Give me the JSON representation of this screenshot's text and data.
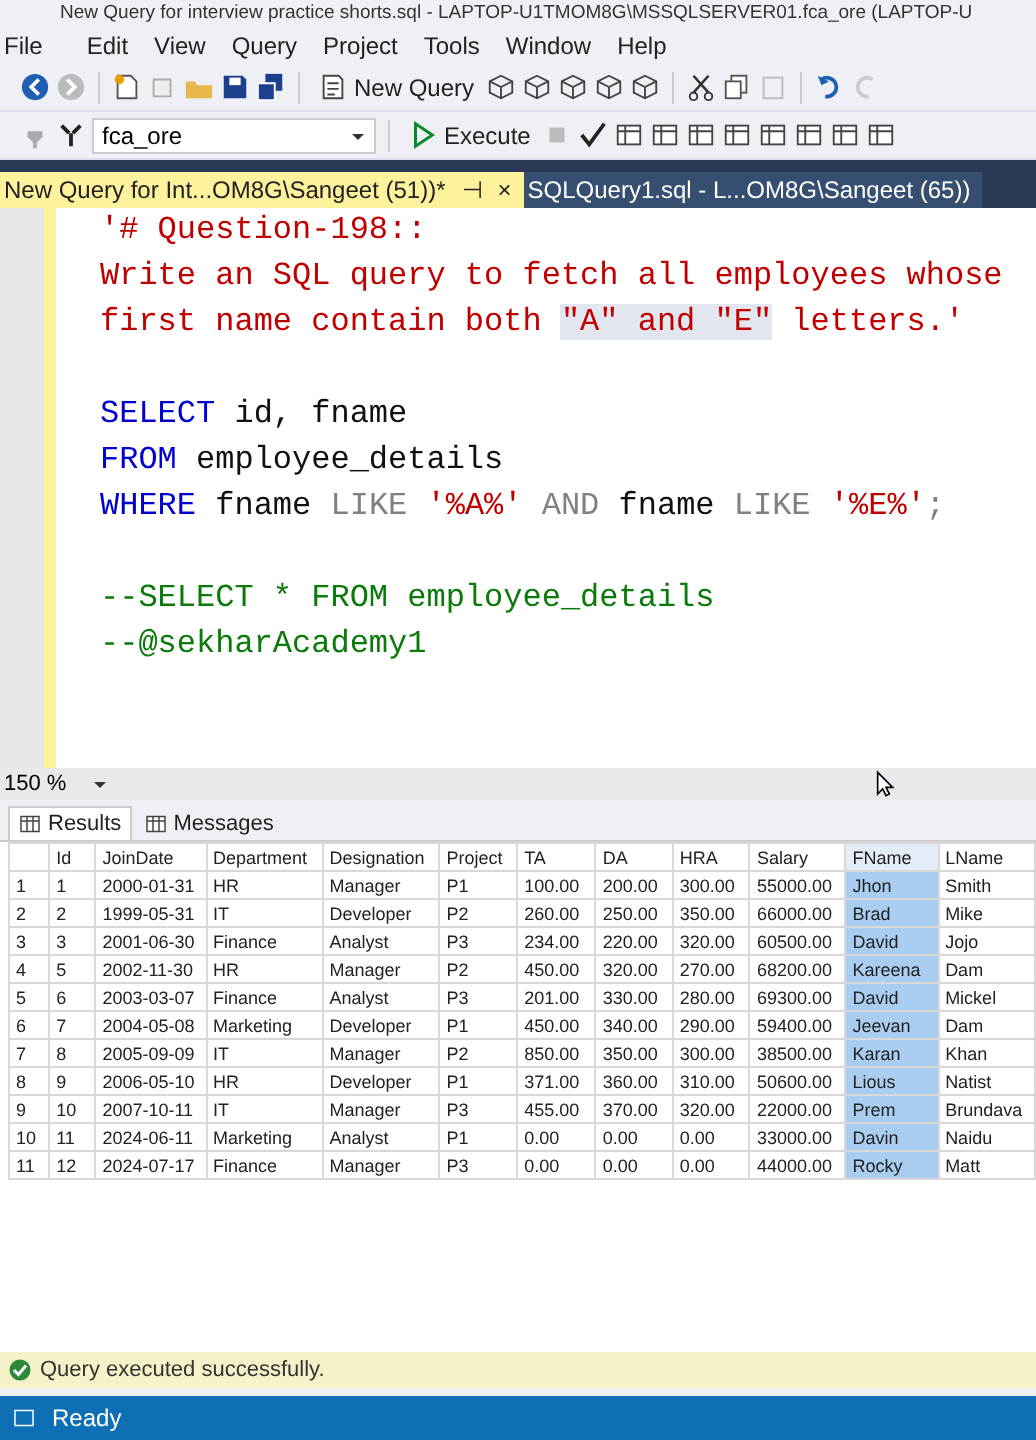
{
  "window": {
    "title": "New Query for interview practice shorts.sql - LAPTOP-U1TMOM8G\\MSSQLSERVER01.fca_ore (LAPTOP-U"
  },
  "menu": [
    "File",
    "Edit",
    "View",
    "Query",
    "Project",
    "Tools",
    "Window",
    "Help"
  ],
  "toolbar": {
    "new_query": "New Query",
    "database": "fca_ore",
    "execute": "Execute"
  },
  "tabs": [
    {
      "label": "New Query for Int...OM8G\\Sangeet (51))*",
      "selected": true,
      "pin": "⊣",
      "close": "×"
    },
    {
      "label": "SQLQuery1.sql - L...OM8G\\Sangeet (65))",
      "selected": false
    }
  ],
  "editor": {
    "lines": [
      {
        "kind": "code",
        "tokens": [
          {
            "text": "'# Question-198::",
            "kind": "string"
          }
        ]
      },
      {
        "kind": "code",
        "tokens": [
          {
            "text": "Write an SQL query to fetch all employees whose",
            "kind": "string"
          }
        ]
      },
      {
        "kind": "code",
        "tokens": [
          {
            "text": "first name contain both ",
            "kind": "string"
          },
          {
            "text": "\"A\" and \"E\"",
            "kind": "string",
            "highlighted": true
          },
          {
            "text": " letters.'",
            "kind": "string"
          }
        ]
      },
      {
        "kind": "blank"
      },
      {
        "kind": "code",
        "tokens": [
          {
            "text": "SELECT",
            "kind": "keyword"
          },
          {
            "text": " id, fname",
            "kind": "plain"
          }
        ]
      },
      {
        "kind": "code",
        "tokens": [
          {
            "text": "FROM",
            "kind": "keyword"
          },
          {
            "text": " employee_details",
            "kind": "plain"
          }
        ]
      },
      {
        "kind": "code",
        "tokens": [
          {
            "text": "WHERE",
            "kind": "keyword"
          },
          {
            "text": " fname ",
            "kind": "plain"
          },
          {
            "text": "LIKE",
            "kind": "operator"
          },
          {
            "text": " '%A%'",
            "kind": "string"
          },
          {
            "text": " AND",
            "kind": "operator"
          },
          {
            "text": " fname ",
            "kind": "plain"
          },
          {
            "text": "LIKE",
            "kind": "operator"
          },
          {
            "text": " '%E%'",
            "kind": "string"
          },
          {
            "text": ";",
            "kind": "operator"
          }
        ]
      },
      {
        "kind": "blank"
      },
      {
        "kind": "code",
        "tokens": [
          {
            "text": "--SELECT * FROM employee_details",
            "kind": "comment"
          }
        ]
      },
      {
        "kind": "code",
        "tokens": [
          {
            "text": "--@sekharAcademy1",
            "kind": "comment"
          }
        ]
      }
    ]
  },
  "zoom": "150 %",
  "result_tabs": [
    {
      "label": "Results",
      "selected": true
    },
    {
      "label": "Messages",
      "selected": false
    }
  ],
  "grid": {
    "columns": [
      {
        "label": "Id",
        "selected": false
      },
      {
        "label": "JoinDate",
        "selected": false
      },
      {
        "label": "Department",
        "selected": false
      },
      {
        "label": "Designation",
        "selected": false
      },
      {
        "label": "Project",
        "selected": false
      },
      {
        "label": "TA",
        "selected": false
      },
      {
        "label": "DA",
        "selected": false
      },
      {
        "label": "HRA",
        "selected": false
      },
      {
        "label": "Salary",
        "selected": false
      },
      {
        "label": "FName",
        "selected": true
      },
      {
        "label": "LName",
        "selected": false
      }
    ],
    "rows": [
      {
        "number": "1",
        "cells": [
          "1",
          "2000-01-31",
          "HR",
          "Manager",
          "P1",
          "100.00",
          "200.00",
          "300.00",
          "55000.00",
          "Jhon",
          "Smith"
        ]
      },
      {
        "number": "2",
        "cells": [
          "2",
          "1999-05-31",
          "IT",
          "Developer",
          "P2",
          "260.00",
          "250.00",
          "350.00",
          "66000.00",
          "Brad",
          "Mike"
        ]
      },
      {
        "number": "3",
        "cells": [
          "3",
          "2001-06-30",
          "Finance",
          "Analyst",
          "P3",
          "234.00",
          "220.00",
          "320.00",
          "60500.00",
          "David",
          "Jojo"
        ]
      },
      {
        "number": "4",
        "cells": [
          "5",
          "2002-11-30",
          "HR",
          "Manager",
          "P2",
          "450.00",
          "320.00",
          "270.00",
          "68200.00",
          "Kareena",
          "Dam"
        ]
      },
      {
        "number": "5",
        "cells": [
          "6",
          "2003-03-07",
          "Finance",
          "Analyst",
          "P3",
          "201.00",
          "330.00",
          "280.00",
          "69300.00",
          "David",
          "Mickel"
        ]
      },
      {
        "number": "6",
        "cells": [
          "7",
          "2004-05-08",
          "Marketing",
          "Developer",
          "P1",
          "450.00",
          "340.00",
          "290.00",
          "59400.00",
          "Jeevan",
          "Dam"
        ]
      },
      {
        "number": "7",
        "cells": [
          "8",
          "2005-09-09",
          "IT",
          "Manager",
          "P2",
          "850.00",
          "350.00",
          "300.00",
          "38500.00",
          "Karan",
          "Khan"
        ]
      },
      {
        "number": "8",
        "cells": [
          "9",
          "2006-05-10",
          "HR",
          "Developer",
          "P1",
          "371.00",
          "360.00",
          "310.00",
          "50600.00",
          "Lious",
          "Natist"
        ]
      },
      {
        "number": "9",
        "cells": [
          "10",
          "2007-10-11",
          "IT",
          "Manager",
          "P3",
          "455.00",
          "370.00",
          "320.00",
          "22000.00",
          "Prem",
          "Brundava"
        ]
      },
      {
        "number": "10",
        "cells": [
          "11",
          "2024-06-11",
          "Marketing",
          "Analyst",
          "P1",
          "0.00",
          "0.00",
          "0.00",
          "33000.00",
          "Davin",
          "Naidu"
        ]
      },
      {
        "number": "11",
        "cells": [
          "12",
          "2024-07-17",
          "Finance",
          "Manager",
          "P3",
          "0.00",
          "0.00",
          "0.00",
          "44000.00",
          "Rocky",
          "Matt"
        ]
      }
    ]
  },
  "message_bar": "Query executed successfully.",
  "status_bar": "Ready"
}
